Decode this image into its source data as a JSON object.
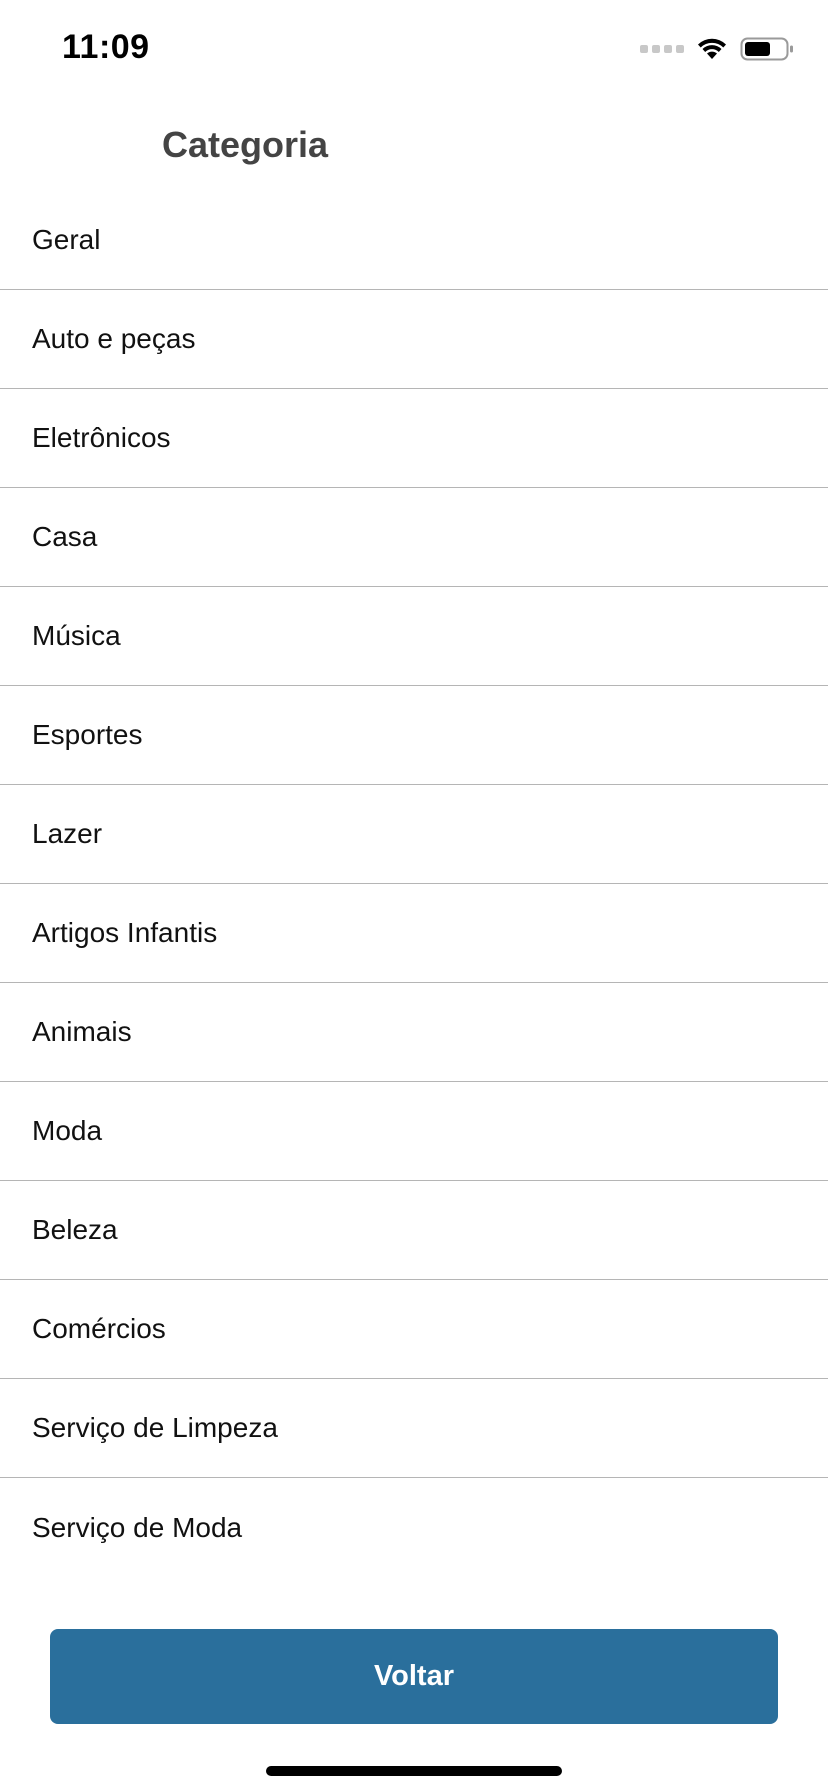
{
  "status_bar": {
    "time": "11:09",
    "icons": [
      "signal-icon",
      "wifi-icon",
      "battery-icon"
    ]
  },
  "header": {
    "title": "Categoria"
  },
  "categories": [
    "Geral",
    "Auto e peças",
    "Eletrônicos",
    "Casa",
    "Música",
    "Esportes",
    "Lazer",
    "Artigos Infantis",
    "Animais",
    "Moda",
    "Beleza",
    "Comércios",
    "Serviço de Limpeza",
    "Serviço de Moda"
  ],
  "footer": {
    "back_label": "Voltar"
  },
  "colors": {
    "accent": "#2a6f9c",
    "title": "#444444",
    "divider": "#b5b5b5"
  }
}
